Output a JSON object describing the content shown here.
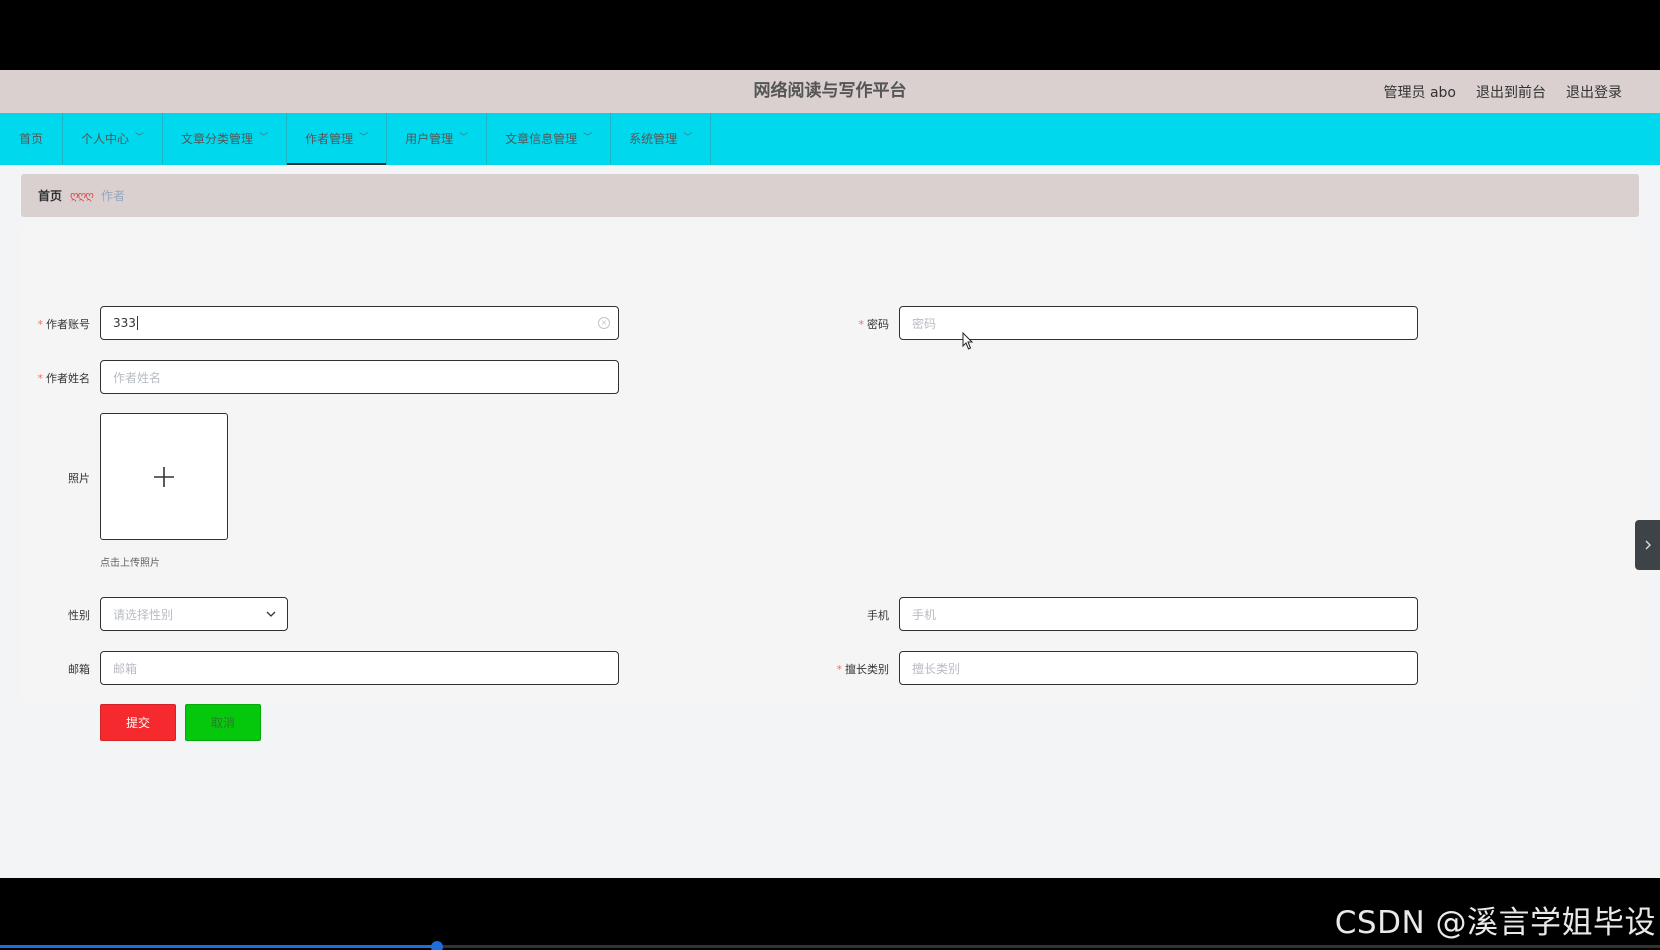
{
  "header": {
    "title": "网络阅读与写作平台",
    "user_label": "管理员 abo",
    "front_link": "退出到前台",
    "logout_link": "退出登录"
  },
  "nav": {
    "items": [
      {
        "label": "首页",
        "has_dropdown": false
      },
      {
        "label": "个人中心",
        "has_dropdown": true
      },
      {
        "label": "文章分类管理",
        "has_dropdown": true
      },
      {
        "label": "作者管理",
        "has_dropdown": true,
        "active": true
      },
      {
        "label": "用户管理",
        "has_dropdown": true
      },
      {
        "label": "文章信息管理",
        "has_dropdown": true
      },
      {
        "label": "系统管理",
        "has_dropdown": true
      }
    ]
  },
  "breadcrumb": {
    "home": "首页",
    "separator": "ღღღ",
    "current": "作者"
  },
  "form": {
    "account": {
      "label": "作者账号",
      "value": "333",
      "required": true
    },
    "password": {
      "label": "密码",
      "placeholder": "密码",
      "required": true
    },
    "name": {
      "label": "作者姓名",
      "placeholder": "作者姓名",
      "required": true
    },
    "photo": {
      "label": "照片",
      "tip": "点击上传照片"
    },
    "gender": {
      "label": "性别",
      "placeholder": "请选择性别"
    },
    "phone": {
      "label": "手机",
      "placeholder": "手机"
    },
    "email": {
      "label": "邮箱",
      "placeholder": "邮箱"
    },
    "specialty": {
      "label": "擅长类别",
      "placeholder": "擅长类别",
      "required": true
    }
  },
  "buttons": {
    "submit": "提交",
    "cancel": "取消"
  },
  "overlay": {
    "watermark": "CSDN @溪言学姐毕设",
    "video_progress": 0.263
  },
  "colors": {
    "nav_bg": "#00d8ee",
    "header_bg": "#d9d0cf",
    "submit_bg": "#f62a2e",
    "cancel_bg": "#05c80c"
  }
}
